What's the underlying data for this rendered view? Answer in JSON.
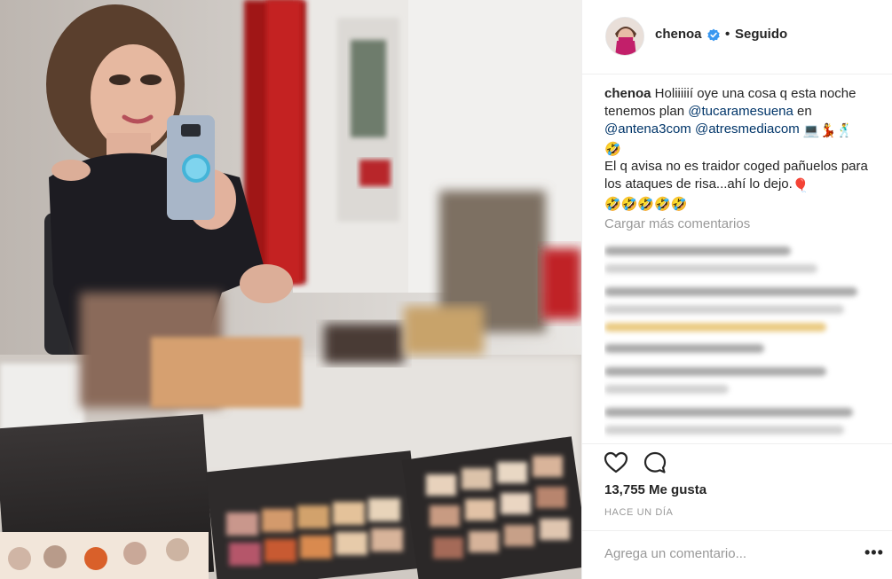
{
  "post": {
    "username": "chenoa",
    "separator": "•",
    "follow_status": "Seguido",
    "caption": {
      "username": "chenoa",
      "t1": " Holiiiiií oye una cosa q esta noche tenemos plan ",
      "mention1": "@tucaramesuena",
      "t2": " en ",
      "mention2": "@antena3com",
      "t3": " ",
      "mention3": "@atresmediacom",
      "emoji1": "💻💃🕺",
      "emoji2": "🤣",
      "t4": "El q avisa no es traidor coged pañuelos para los ataques de risa...ahí lo dejo.",
      "emoji3": "🎈",
      "emoji4": "🤣🤣🤣🤣🤣"
    },
    "load_more": "Cargar más comentarios",
    "likes": "13,755 Me gusta",
    "time_ago": "HACE UN DÍA",
    "comment_placeholder": "Agrega un comentario...",
    "more_options": "•••"
  },
  "icons": {
    "like": "heart-icon",
    "comment": "comment-bubble-icon",
    "verified": "verified-badge-icon",
    "more": "more-options-icon"
  },
  "colors": {
    "text": "#262626",
    "muted": "#999999",
    "mention": "#003569",
    "verified": "#3897f0",
    "divider": "#efefef"
  }
}
